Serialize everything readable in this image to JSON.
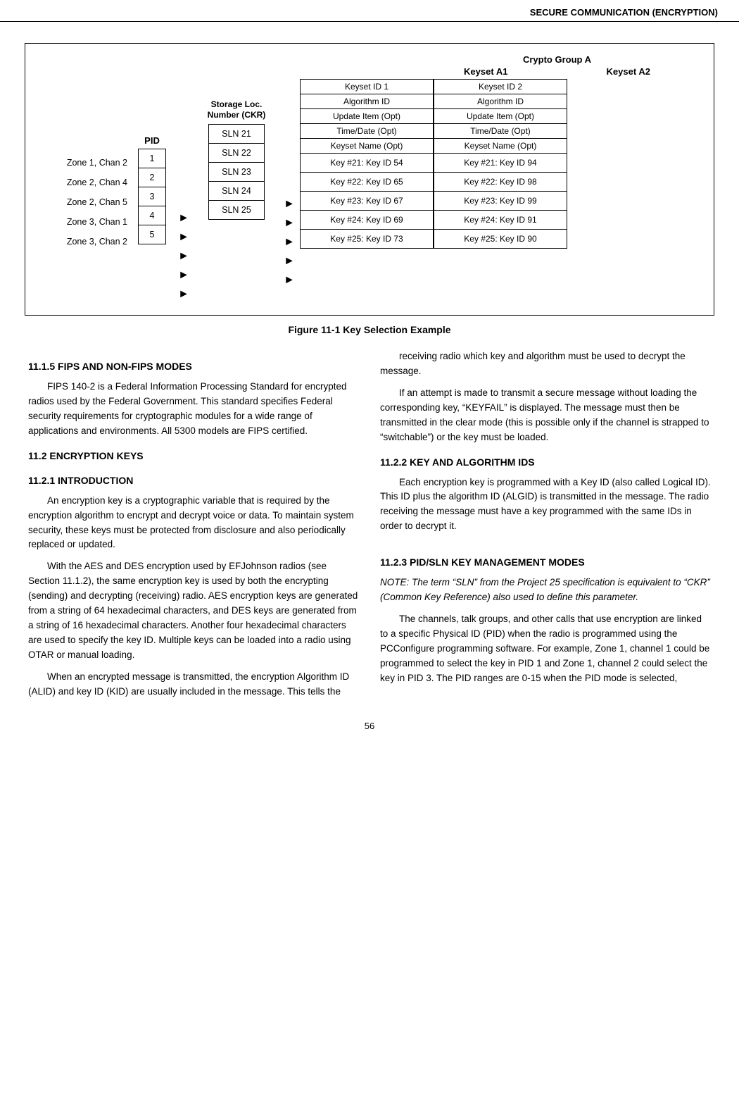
{
  "header": {
    "title": "SECURE COMMUNICATION (ENCRYPTION)"
  },
  "figure": {
    "caption": "Figure 11-1   Key Selection Example",
    "crypto_group_label": "Crypto Group A",
    "keyset_a1_label": "Keyset A1",
    "keyset_a2_label": "Keyset A2",
    "pid_header": "PID",
    "sln_header": "Storage Loc.\nNumber (CKR)",
    "keyset1_headers": [
      "Keyset ID 1",
      "Algorithm ID",
      "Update Item (Opt)",
      "Time/Date (Opt)",
      "Keyset Name (Opt)"
    ],
    "keyset2_headers": [
      "Keyset ID 2",
      "Algorithm ID",
      "Update Item (Opt)",
      "Time/Date (Opt)",
      "Keyset Name (Opt)"
    ],
    "rows": [
      {
        "zone": "Zone 1, Chan 2",
        "pid": "1",
        "sln": "SLN 21",
        "key1": "Key #21: Key ID 54",
        "key2": "Key #21: Key ID 94"
      },
      {
        "zone": "Zone 2, Chan 4",
        "pid": "2",
        "sln": "SLN 22",
        "key1": "Key #22: Key ID 65",
        "key2": "Key #22: Key ID 98"
      },
      {
        "zone": "Zone 2, Chan 5",
        "pid": "3",
        "sln": "SLN 23",
        "key1": "Key #23: Key ID 67",
        "key2": "Key #23: Key ID 99"
      },
      {
        "zone": "Zone 3, Chan 1",
        "pid": "4",
        "sln": "SLN 24",
        "key1": "Key #24: Key ID 69",
        "key2": "Key #24: Key ID 91"
      },
      {
        "zone": "Zone 3, Chan 2",
        "pid": "5",
        "sln": "SLN 25",
        "key1": "Key #25: Key ID 73",
        "key2": "Key #25: Key ID 90"
      }
    ]
  },
  "sections": {
    "s11_1_5": {
      "heading": "11.1.5  FIPS AND NON-FIPS MODES",
      "p1": "FIPS 140-2 is a Federal Information Processing Standard for encrypted radios used by the Federal Government. This standard specifies Federal security requirements for cryptographic modules for a wide range of applications and environments. All 5300 models are FIPS certified."
    },
    "s11_2": {
      "heading": "11.2 ENCRYPTION KEYS"
    },
    "s11_2_1": {
      "heading": "11.2.1  INTRODUCTION",
      "p1": "An encryption key is a cryptographic variable that is required by the encryption algorithm to encrypt and decrypt voice or data. To maintain system security, these keys must be protected from disclosure and also periodically replaced or updated.",
      "p2": "With the AES and DES encryption used by EFJohnson radios (see Section 11.1.2), the same encryption key is used by both the encrypting (sending) and decrypting (receiving) radio. AES encryption keys are generated from a string of 64 hexadecimal characters, and DES keys are generated from a string of 16 hexadecimal characters. Another four hexadecimal characters are used to specify the key ID. Multiple keys can be loaded into a radio using OTAR or manual loading.",
      "p3": "When an encrypted message is transmitted, the encryption Algorithm ID (ALID) and key ID (KID) are usually included in the message. This tells the"
    },
    "s11_2_right": {
      "p1": "receiving radio which key and algorithm must be used to decrypt the message.",
      "p2": "If an attempt is made to transmit a secure message without loading the corresponding key, “KEYFAIL” is displayed. The message must then be transmitted in the clear mode (this is possible only if the channel is strapped to “switchable”) or the key must be loaded."
    },
    "s11_2_2": {
      "heading": "11.2.2  KEY AND ALGORITHM IDS",
      "p1": "Each encryption key is programmed with a Key ID (also called Logical ID). This ID plus the algorithm ID (ALGID) is transmitted in the message. The radio receiving the message must have a key programmed with the same IDs in order to decrypt it."
    },
    "s11_2_3": {
      "heading": "11.2.3  PID/SLN KEY MANAGEMENT MODES",
      "note": "NOTE: The term “SLN” from the Project 25 specification is equivalent to “CKR” (Common Key Reference) also used to define this parameter.",
      "p1": "The channels, talk groups, and other calls that use encryption are linked to a specific Physical ID (PID) when the radio is programmed using the PCConfigure programming software. For example, Zone 1, channel 1 could be programmed to select the key in PID 1 and Zone 1, channel 2 could select the key in PID 3. The PID ranges are 0-15 when the PID mode is selected,"
    }
  },
  "page_number": "56"
}
